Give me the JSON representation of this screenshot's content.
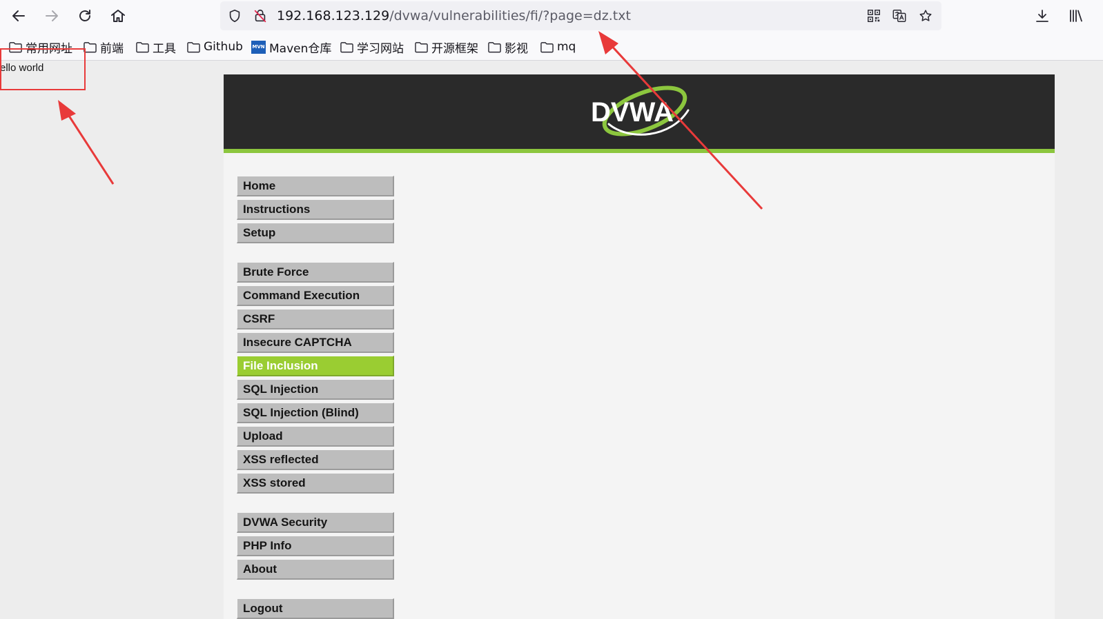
{
  "browser": {
    "url_host": "192.168.123.129",
    "url_path": "/dvwa/vulnerabilities/fi/?page=dz.txt",
    "icons": {
      "back": "arrow-left-icon",
      "forward": "arrow-right-icon",
      "reload": "reload-icon",
      "home": "home-icon",
      "tracking": "shield-icon",
      "insecure": "insecure-lock-icon",
      "qr": "qr-code-icon",
      "translate": "translate-icon",
      "bookmark": "star-icon",
      "downloads": "download-icon",
      "library": "library-icon"
    }
  },
  "bookmarks": [
    {
      "label": "常用网址",
      "icon": "folder-icon"
    },
    {
      "label": "前端",
      "icon": "folder-icon"
    },
    {
      "label": "工具",
      "icon": "folder-icon"
    },
    {
      "label": "Github",
      "icon": "folder-icon"
    },
    {
      "label": "Maven仓库",
      "icon": "maven-icon",
      "icon_text": "MVN"
    },
    {
      "label": "学习网站",
      "icon": "folder-icon"
    },
    {
      "label": "开源框架",
      "icon": "folder-icon"
    },
    {
      "label": "影视",
      "icon": "folder-icon"
    },
    {
      "label": "mq",
      "icon": "folder-icon"
    }
  ],
  "page": {
    "included_output": "ello world"
  },
  "dvwa": {
    "logo_text": "DVWA",
    "menu_groups": [
      [
        {
          "label": "Home"
        },
        {
          "label": "Instructions"
        },
        {
          "label": "Setup"
        }
      ],
      [
        {
          "label": "Brute Force"
        },
        {
          "label": "Command Execution"
        },
        {
          "label": "CSRF"
        },
        {
          "label": "Insecure CAPTCHA"
        },
        {
          "label": "File Inclusion",
          "active": true
        },
        {
          "label": "SQL Injection"
        },
        {
          "label": "SQL Injection (Blind)"
        },
        {
          "label": "Upload"
        },
        {
          "label": "XSS reflected"
        },
        {
          "label": "XSS stored"
        }
      ],
      [
        {
          "label": "DVWA Security"
        },
        {
          "label": "PHP Info"
        },
        {
          "label": "About"
        }
      ],
      [
        {
          "label": "Logout"
        }
      ]
    ]
  },
  "colors": {
    "dvwa_green": "#8cc63e",
    "active_menu": "#9acd32",
    "menu_gray": "#bdbdbd",
    "header_dark": "#2a2a2a",
    "annotation_red": "#e83a3a"
  }
}
